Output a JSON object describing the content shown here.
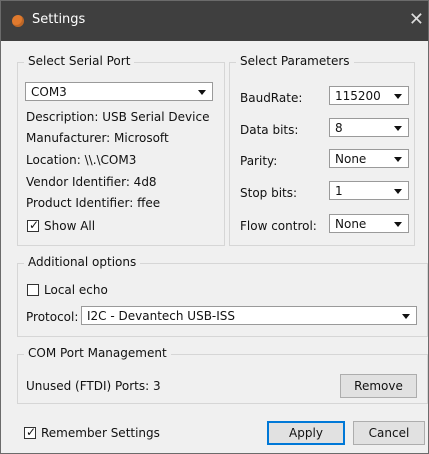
{
  "window": {
    "title": "Settings",
    "close_glyph": "✕",
    "icon": "app-icon"
  },
  "serial_port": {
    "title": "Select Serial Port",
    "port_value": "COM3",
    "description": "Description: USB Serial Device",
    "manufacturer": "Manufacturer: Microsoft",
    "location": "Location: \\\\.\\COM3",
    "vendor": "Vendor Identifier: 4d8",
    "product": "Product Identifier: ffee",
    "show_all_label": "Show All",
    "show_all_checked": true
  },
  "parameters": {
    "title": "Select Parameters",
    "baudrate_label": "BaudRate:",
    "baudrate_value": "115200",
    "databits_label": "Data bits:",
    "databits_value": "8",
    "parity_label": "Parity:",
    "parity_value": "None",
    "stopbits_label": "Stop bits:",
    "stopbits_value": "1",
    "flow_label": "Flow control:",
    "flow_value": "None"
  },
  "additional": {
    "title": "Additional options",
    "local_echo_label": "Local echo",
    "local_echo_checked": false,
    "protocol_label": "Protocol:",
    "protocol_value": "I2C - Devantech USB-ISS"
  },
  "com_mgmt": {
    "title": "COM Port Management",
    "unused_text": "Unused (FTDI) Ports: 3",
    "remove_label": "Remove"
  },
  "footer": {
    "remember_label": "Remember Settings",
    "remember_checked": true,
    "apply_label": "Apply",
    "cancel_label": "Cancel"
  },
  "colors": {
    "titlebar": "#3f3f3f",
    "accent": "#0078d7",
    "background": "#f0f0f0"
  }
}
